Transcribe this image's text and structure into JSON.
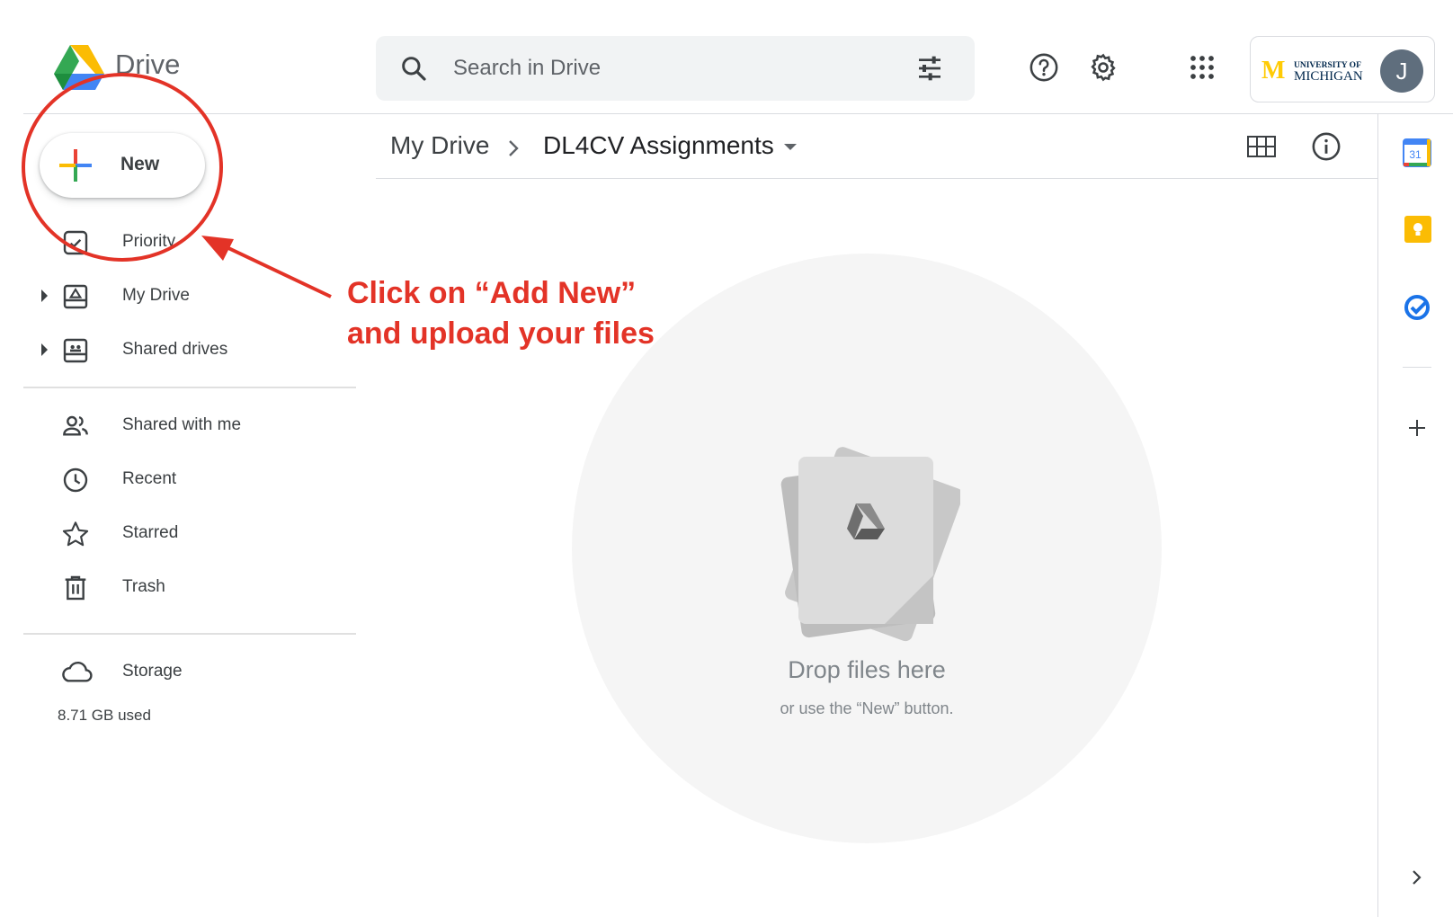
{
  "header": {
    "app_name": "Drive",
    "search_placeholder": "Search in Drive",
    "org_logo_text": [
      "UNIVERSITY OF",
      "MICHIGAN"
    ],
    "avatar_initial": "J"
  },
  "new_button": {
    "label": "New"
  },
  "nav": {
    "priority": "Priority",
    "my_drive": "My Drive",
    "shared_drives": "Shared drives",
    "shared_with_me": "Shared with me",
    "recent": "Recent",
    "starred": "Starred",
    "trash": "Trash",
    "storage": "Storage",
    "storage_used": "8.71 GB used"
  },
  "breadcrumb": {
    "root": "My Drive",
    "current": "DL4CV Assignments"
  },
  "drop_zone": {
    "title": "Drop files here",
    "subtitle": "or use the “New” button."
  },
  "side_panel": {
    "calendar_day": "31"
  },
  "annotation": {
    "line1": "Click on “Add New”",
    "line2": "and upload your files"
  },
  "colors": {
    "annotation_red": "#e33327",
    "google_blue": "#4285f4",
    "google_red": "#ea4335",
    "google_yellow": "#fbbc04",
    "google_green": "#34a853",
    "michigan_maize": "#ffcb05",
    "michigan_blue": "#00274c"
  },
  "icons": [
    "drive-logo-icon",
    "search-icon",
    "tune-icon",
    "help-icon",
    "settings-icon",
    "apps-grid-icon",
    "plus-icon",
    "priority-icon",
    "my-drive-icon",
    "shared-drives-icon",
    "people-icon",
    "clock-icon",
    "star-icon",
    "trash-icon",
    "cloud-icon",
    "chevron-right-icon",
    "grid-view-icon",
    "info-icon",
    "calendar-icon",
    "keep-icon",
    "tasks-icon",
    "add-icon"
  ]
}
